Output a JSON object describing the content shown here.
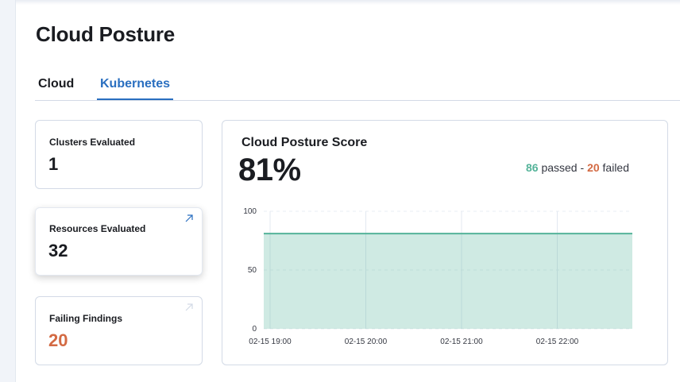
{
  "page": {
    "title": "Cloud Posture"
  },
  "tabs": [
    {
      "label": "Cloud",
      "selected": false
    },
    {
      "label": "Kubernetes",
      "selected": true
    }
  ],
  "cards": {
    "clusters": {
      "label": "Clusters Evaluated",
      "value": "1"
    },
    "resources": {
      "label": "Resources Evaluated",
      "value": "32"
    },
    "failing": {
      "label": "Failing Findings",
      "value": "20"
    }
  },
  "score": {
    "title": "Cloud Posture Score",
    "value": "81%",
    "passed_count": "86",
    "passed_label": "passed",
    "separator": "-",
    "failed_count": "20",
    "failed_label": "failed"
  },
  "colors": {
    "accent": "#2a6fc0",
    "passed": "#54b399",
    "failed": "#d36a43"
  },
  "icons": {
    "card_link": "arrow-up-right-icon"
  },
  "chart_data": {
    "type": "area",
    "x": [
      "02-15 19:00",
      "02-15 20:00",
      "02-15 21:00",
      "02-15 22:00"
    ],
    "x_ticks": [
      "02-15 19:00",
      "02-15 20:00",
      "02-15 21:00",
      "02-15 22:00"
    ],
    "y_ticks": [
      "0",
      "50",
      "100"
    ],
    "series": [
      {
        "values": [
          81,
          81,
          81,
          81
        ]
      }
    ],
    "ylim": [
      0,
      100
    ],
    "grid": true,
    "color": "#54b399"
  }
}
